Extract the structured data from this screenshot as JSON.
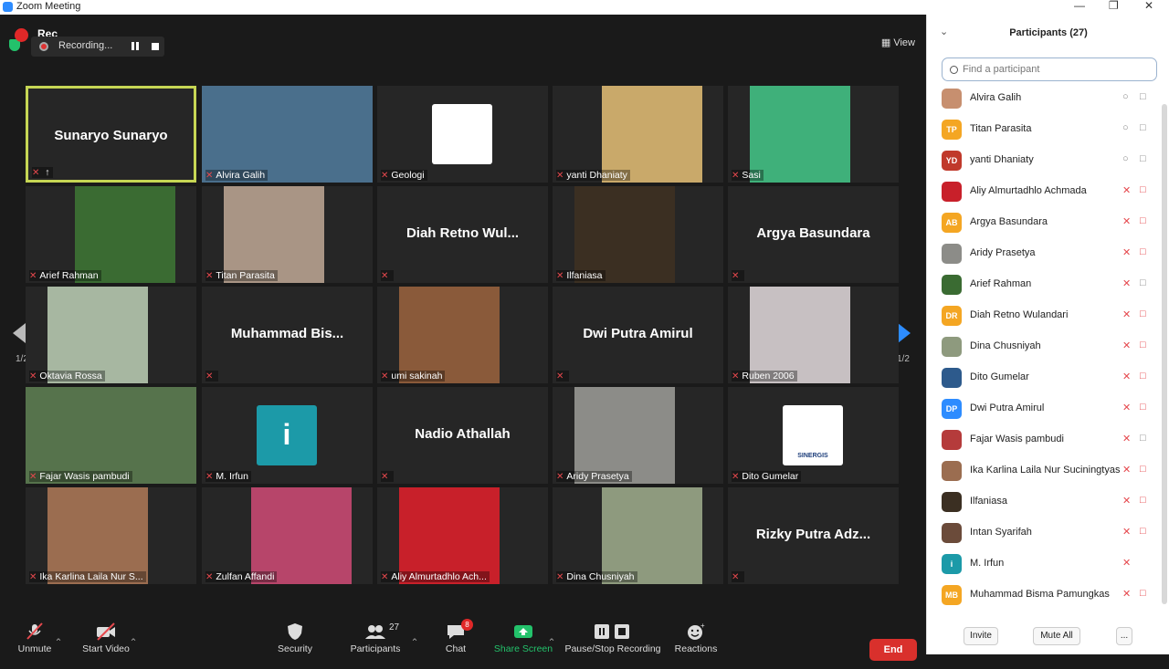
{
  "window": {
    "title": "Zoom Meeting"
  },
  "recording": {
    "badge": "Rec",
    "status": "Recording...",
    "view_label": "View"
  },
  "paging": {
    "left": "1/2",
    "right": "1/2"
  },
  "tiles": [
    {
      "name": "Sunaryo Sunaryo",
      "big": "Sunaryo Sunaryo",
      "label": "",
      "active": true
    },
    {
      "name": "Alvira Galih",
      "label": "Alvira Galih",
      "photo": "#4a6f8c"
    },
    {
      "name": "Geologi",
      "label": "Geologi",
      "logo": "#ffffff"
    },
    {
      "name": "yanti Dhaniaty",
      "label": "yanti Dhaniaty",
      "photo": "#c9a96a"
    },
    {
      "name": "Sasi",
      "label": "Sasi",
      "photo": "#3fb07a"
    },
    {
      "name": "Arief Rahman",
      "label": "Arief Rahman",
      "photo": "#3a6b32"
    },
    {
      "name": "Titan Parasita",
      "label": "Titan Parasita",
      "photo": "#a99585"
    },
    {
      "name": "Diah Retno Wul...",
      "big": "Diah Retno Wul...",
      "label": ""
    },
    {
      "name": "Ilfaniasa",
      "label": "Ilfaniasa",
      "photo": "#3b2f22"
    },
    {
      "name": "Argya Basundara",
      "big": "Argya Basundara",
      "label": ""
    },
    {
      "name": "Oktavia Rossa",
      "label": "Oktavia Rossa",
      "photo": "#a7b7a1"
    },
    {
      "name": "Muhammad Bis...",
      "big": "Muhammad  Bis...",
      "label": ""
    },
    {
      "name": "umi sakinah",
      "label": "umi sakinah",
      "photo": "#8a5a3a"
    },
    {
      "name": "Dwi Putra Amirul",
      "big": "Dwi Putra Amirul",
      "label": ""
    },
    {
      "name": "Ruben 2006",
      "label": "Ruben 2006",
      "photo": "#c7c0c2"
    },
    {
      "name": "Fajar Wasis pambudi",
      "label": "Fajar Wasis pambudi",
      "photo": "#56734c"
    },
    {
      "name": "M. Irfun",
      "label": "M. Irfun",
      "logo": "#1c9aa8",
      "logo_text": "i"
    },
    {
      "name": "Nadio Athallah",
      "big": "Nadio Athallah",
      "label": ""
    },
    {
      "name": "Aridy Prasetya",
      "label": "Aridy Prasetya",
      "photo": "#8c8c88"
    },
    {
      "name": "Dito Gumelar",
      "label": "Dito Gumelar",
      "logo": "#ffffff",
      "logo_text": "SINERGIS"
    },
    {
      "name": "Ika Karlina Laila Nur S...",
      "label": "Ika Karlina Laila Nur S...",
      "photo": "#9b6d50"
    },
    {
      "name": "Zulfan Affandi",
      "label": "Zulfan Affandi",
      "photo": "#b7456a"
    },
    {
      "name": "Aliy Almurtadhlo Ach...",
      "label": "Aliy Almurtadhlo Ach...",
      "photo": "#c8202a"
    },
    {
      "name": "Dina Chusniyah",
      "label": "Dina Chusniyah",
      "photo": "#8e9a7e"
    },
    {
      "name": "Rizky Putra Adz...",
      "big": "Rizky Putra Adz...",
      "label": ""
    }
  ],
  "toolbar": {
    "unmute": "Unmute",
    "start_video": "Start Video",
    "security": "Security",
    "participants": "Participants",
    "participants_count": "27",
    "chat": "Chat",
    "chat_badge": "8",
    "share": "Share Screen",
    "record": "Pause/Stop Recording",
    "reactions": "Reactions",
    "end": "End"
  },
  "panel": {
    "title": "Participants (27)",
    "search_placeholder": "Find a participant",
    "invite": "Invite",
    "mute_all": "Mute All",
    "more": "...",
    "participants": [
      {
        "initials": "",
        "name": "Alvira Galih",
        "color": "#c78f6f",
        "muted": false,
        "video": "off-gray"
      },
      {
        "initials": "TP",
        "name": "Titan Parasita",
        "color": "#f4a623",
        "muted": false,
        "video": "off-gray"
      },
      {
        "initials": "YD",
        "name": "yanti Dhaniaty",
        "color": "#c0392b",
        "muted": false,
        "video": "off-gray"
      },
      {
        "initials": "",
        "name": "Aliy Almurtadhlo Achmada",
        "color": "#c8202a",
        "muted": true,
        "video": "off-red"
      },
      {
        "initials": "AB",
        "name": "Argya Basundara",
        "color": "#f4a623",
        "muted": true,
        "video": "off-red"
      },
      {
        "initials": "",
        "name": "Aridy Prasetya",
        "color": "#8c8c88",
        "muted": true,
        "video": "off-red"
      },
      {
        "initials": "",
        "name": "Arief Rahman",
        "color": "#3a6b32",
        "muted": true,
        "video": "off-gray"
      },
      {
        "initials": "DR",
        "name": "Diah Retno Wulandari",
        "color": "#f4a623",
        "muted": true,
        "video": "off-red"
      },
      {
        "initials": "",
        "name": "Dina Chusniyah",
        "color": "#8e9a7e",
        "muted": true,
        "video": "off-red"
      },
      {
        "initials": "",
        "name": "Dito Gumelar",
        "color": "#2d5a8c",
        "muted": true,
        "video": "off-red"
      },
      {
        "initials": "DP",
        "name": "Dwi Putra Amirul",
        "color": "#2d8cff",
        "muted": true,
        "video": "off-red"
      },
      {
        "initials": "",
        "name": "Fajar Wasis pambudi",
        "color": "#b53b3b",
        "muted": true,
        "video": "off-gray"
      },
      {
        "initials": "",
        "name": "Ika Karlina Laila Nur Suciningtyas",
        "color": "#9b6d50",
        "muted": true,
        "video": "off-red"
      },
      {
        "initials": "",
        "name": "Ilfaniasa",
        "color": "#3b2f22",
        "muted": true,
        "video": "off-red"
      },
      {
        "initials": "",
        "name": "Intan Syarifah",
        "color": "#6b4b3a",
        "muted": true,
        "video": "off-red"
      },
      {
        "initials": "i",
        "name": "M. Irfun",
        "color": "#1c9aa8",
        "muted": true,
        "video": "none"
      },
      {
        "initials": "MB",
        "name": "Muhammad Bisma Pamungkas",
        "color": "#f4a623",
        "muted": true,
        "video": "off-red"
      }
    ]
  }
}
